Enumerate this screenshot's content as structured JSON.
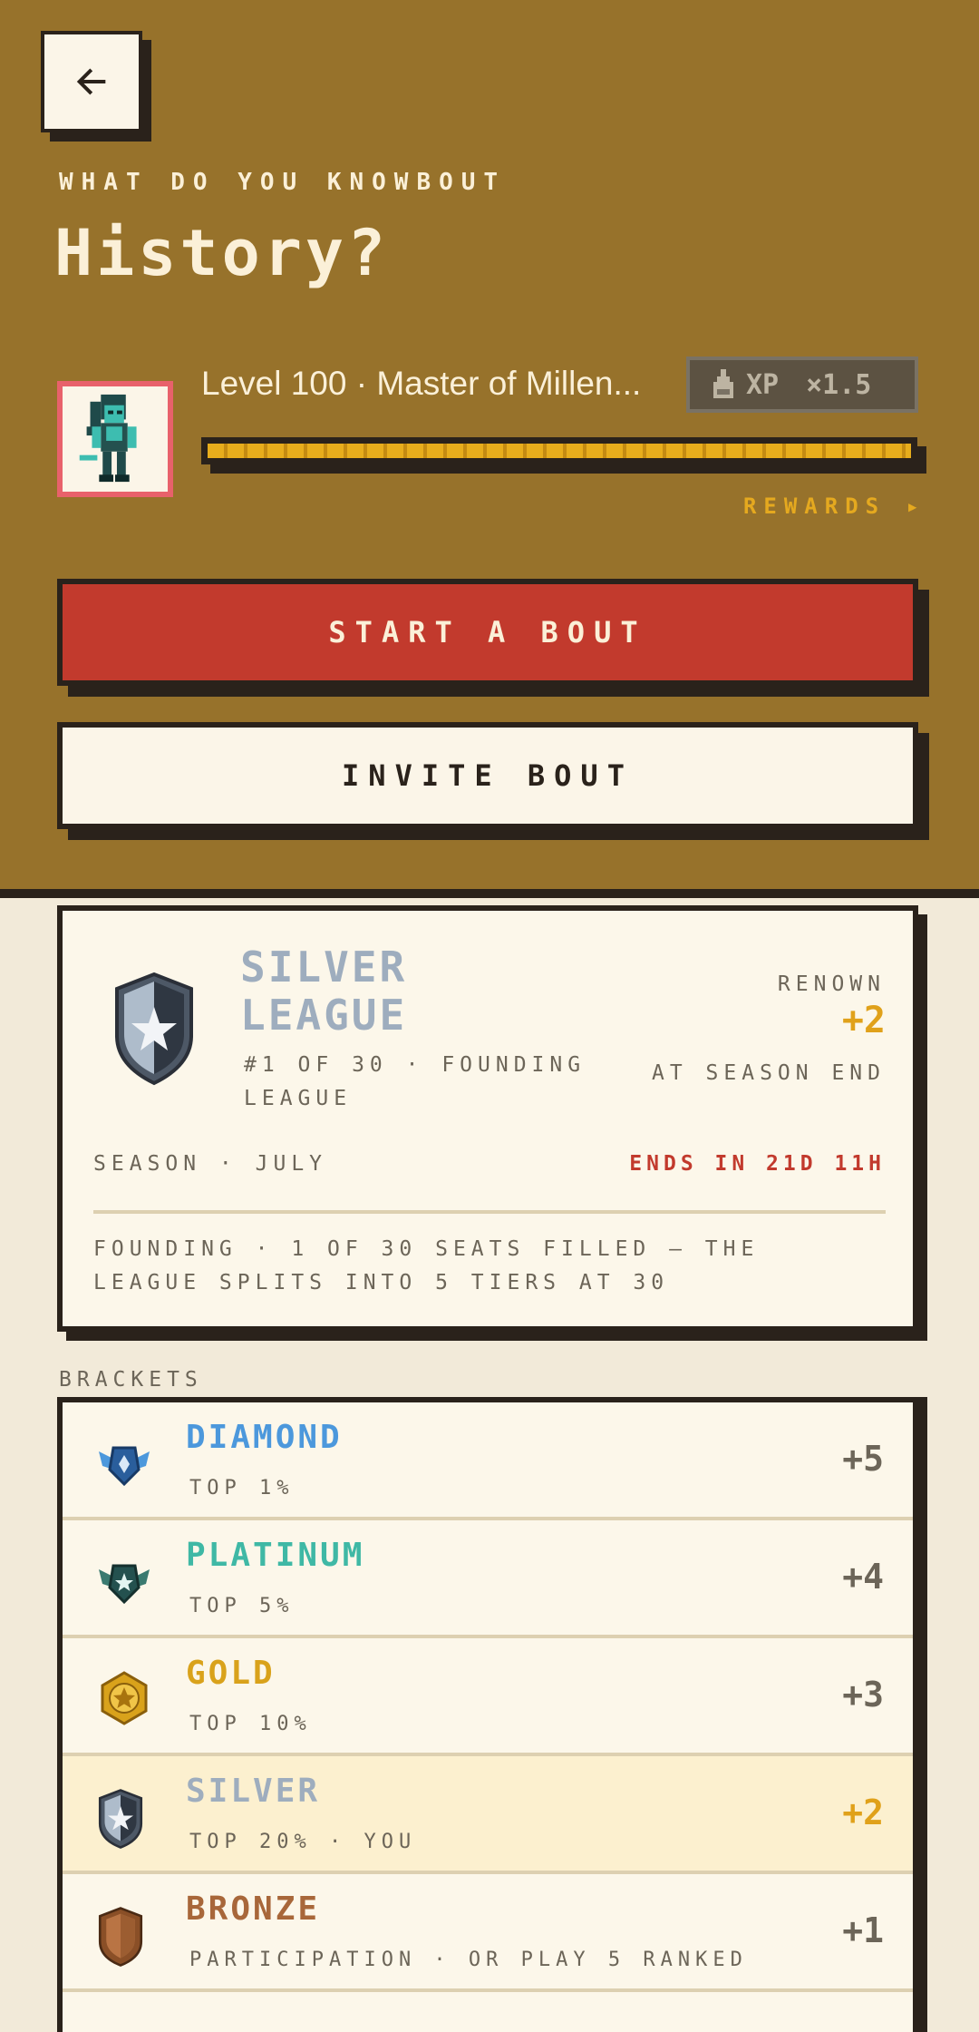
{
  "header": {
    "eyebrow": "WHAT DO YOU KNOWBOUT",
    "title": "History?"
  },
  "player": {
    "level_text": "Level 100 · Master of Millen...",
    "xp_badge": {
      "label": "XP",
      "multiplier": "×1.5"
    },
    "xp_progress": 1.0,
    "rewards_label": "REWARDS ▸"
  },
  "actions": {
    "start_label": "START A BOUT",
    "invite_label": "INVITE BOUT"
  },
  "league": {
    "name": "SILVER LEAGUE",
    "rank": "#1 OF 30 · FOUNDING LEAGUE",
    "renown_label": "RENOWN",
    "renown_value": "+2",
    "season_end_label": "AT SEASON END",
    "season": "SEASON · JULY",
    "ends_in": "ENDS IN 21D 11H",
    "founding_note": "FOUNDING · 1 OF 30 SEATS FILLED — THE LEAGUE SPLITS INTO 5 TIERS AT 30"
  },
  "brackets": {
    "heading": "BRACKETS",
    "items": [
      {
        "name": "DIAMOND",
        "sub": "TOP 1%",
        "bonus": "+5",
        "color": "#4c98dc",
        "icon": "diamond-wing-badge"
      },
      {
        "name": "PLATINUM",
        "sub": "TOP 5%",
        "bonus": "+4",
        "color": "#3fb8a5",
        "icon": "platinum-wing-badge"
      },
      {
        "name": "GOLD",
        "sub": "TOP 10%",
        "bonus": "+3",
        "color": "#d9a21b",
        "icon": "gold-star-badge"
      },
      {
        "name": "SILVER",
        "sub": "TOP 20%  · YOU",
        "bonus": "+2",
        "color": "#9eadbe",
        "icon": "silver-star-shield",
        "you": true
      },
      {
        "name": "BRONZE",
        "sub": "PARTICIPATION · OR PLAY 5 RANKED",
        "bonus": "+1",
        "color": "#a8673a",
        "icon": "bronze-shield"
      }
    ]
  }
}
